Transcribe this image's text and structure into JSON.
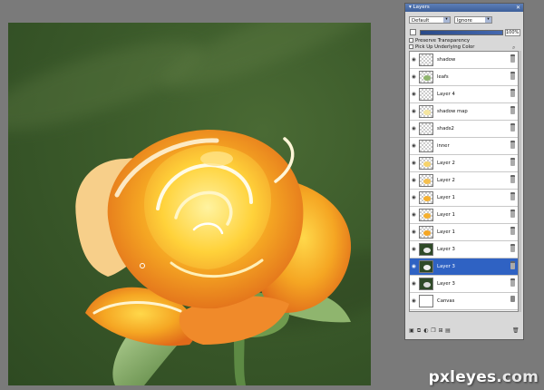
{
  "panel": {
    "title": "Layers",
    "close_glyph": "✕",
    "blend_mode": "Default",
    "mode_option": "Ignore",
    "opacity": "100%",
    "preserve_transparency": "Preserve Transparency",
    "pick_up_underlying_color": "Pick Up Underlying Color"
  },
  "layers": [
    {
      "name": "shadow",
      "thumb": "checker",
      "selected": false
    },
    {
      "name": "leafs",
      "thumb": "checker",
      "selected": false
    },
    {
      "name": "Layer 4",
      "thumb": "checker",
      "selected": false
    },
    {
      "name": "shadow map",
      "thumb": "checker",
      "selected": false
    },
    {
      "name": "shads2",
      "thumb": "checker",
      "selected": false
    },
    {
      "name": "inner",
      "thumb": "checker",
      "selected": false
    },
    {
      "name": "Layer 2",
      "thumb": "checker",
      "selected": false
    },
    {
      "name": "Layer 2",
      "thumb": "checker",
      "selected": false
    },
    {
      "name": "Layer 1",
      "thumb": "checker",
      "selected": false
    },
    {
      "name": "Layer 1",
      "thumb": "checker",
      "selected": false
    },
    {
      "name": "Layer 1",
      "thumb": "checker",
      "selected": false
    },
    {
      "name": "Layer 3",
      "thumb": "white",
      "selected": false
    },
    {
      "name": "Layer 3",
      "thumb": "dark",
      "selected": true
    },
    {
      "name": "Layer 3",
      "thumb": "dark",
      "selected": false
    },
    {
      "name": "Canvas",
      "thumb": "white",
      "selected": false
    }
  ],
  "watermark": {
    "brand": "pxleyes",
    "suffix": ".com"
  },
  "colors": {
    "accent": "#2f62c3",
    "rose": "#f5a623",
    "leaf": "#7aa35a",
    "background": "#3b5a2a"
  }
}
